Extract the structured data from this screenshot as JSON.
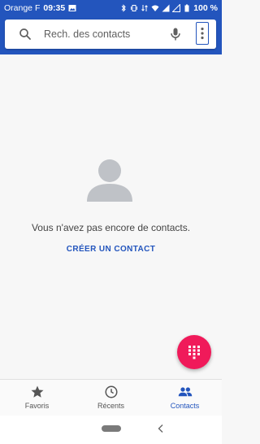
{
  "status_bar": {
    "carrier": "Orange F",
    "time": "09:35",
    "battery": "100 %"
  },
  "search": {
    "placeholder": "Rech. des contacts",
    "icons": [
      "search-icon",
      "mic-icon",
      "more-vert-icon"
    ]
  },
  "empty_state": {
    "message": "Vous n'avez pas encore de contacts.",
    "create_label": "CRÉER UN CONTACT"
  },
  "fab": {
    "icon": "dialpad-icon",
    "color": "#f01a5a"
  },
  "bottom_nav": {
    "items": [
      {
        "label": "Favoris",
        "icon": "star-icon",
        "active": false
      },
      {
        "label": "Récents",
        "icon": "clock-icon",
        "active": false
      },
      {
        "label": "Contacts",
        "icon": "people-icon",
        "active": true
      }
    ]
  },
  "colors": {
    "primary": "#2355bd",
    "background": "#f7f7f7",
    "avatar": "#bfc2c7"
  }
}
